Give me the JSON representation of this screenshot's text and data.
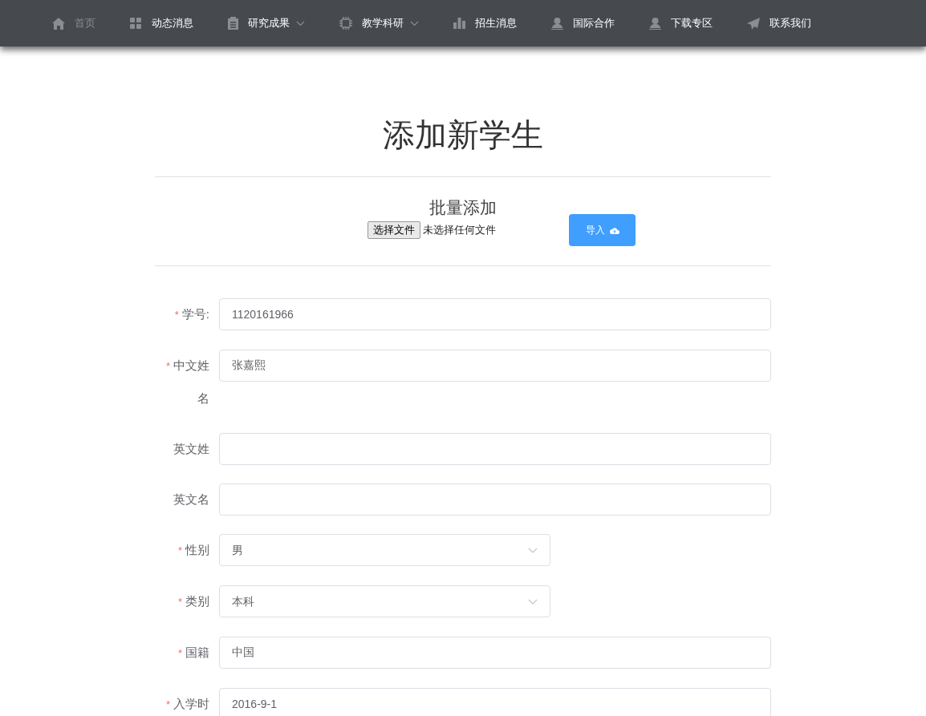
{
  "nav": [
    {
      "label": "首页",
      "selected": true,
      "dropdown": false
    },
    {
      "label": "动态消息",
      "selected": false,
      "dropdown": false
    },
    {
      "label": "研究成果",
      "selected": false,
      "dropdown": true
    },
    {
      "label": "教学科研",
      "selected": false,
      "dropdown": true
    },
    {
      "label": "招生消息",
      "selected": false,
      "dropdown": false
    },
    {
      "label": "国际合作",
      "selected": false,
      "dropdown": false
    },
    {
      "label": "下载专区",
      "selected": false,
      "dropdown": false
    },
    {
      "label": "联系我们",
      "selected": false,
      "dropdown": false
    }
  ],
  "title": "添加新学生",
  "batch": {
    "heading": "批量添加",
    "file_button": "选择文件",
    "file_status": "未选择任何文件",
    "import_button": "导入"
  },
  "fields": [
    {
      "label": "学号:",
      "required_mark": "*",
      "kind": "input",
      "value": "1120161966"
    },
    {
      "label": "中文姓名",
      "required_mark": "*",
      "kind": "input",
      "value": "张嘉熙"
    },
    {
      "label": "英文姓",
      "kind": "input"
    },
    {
      "label": "英文名",
      "kind": "input"
    },
    {
      "label": "性别",
      "required_mark": "*",
      "kind": "select",
      "value": "男"
    },
    {
      "label": "类别",
      "required_mark": "*",
      "kind": "select",
      "value": "本科"
    },
    {
      "label": "国籍",
      "required_mark": "*",
      "kind": "input",
      "value": "中国"
    },
    {
      "label": "入学时",
      "required_mark": "*",
      "kind": "input",
      "value": "2016-9-1"
    }
  ]
}
